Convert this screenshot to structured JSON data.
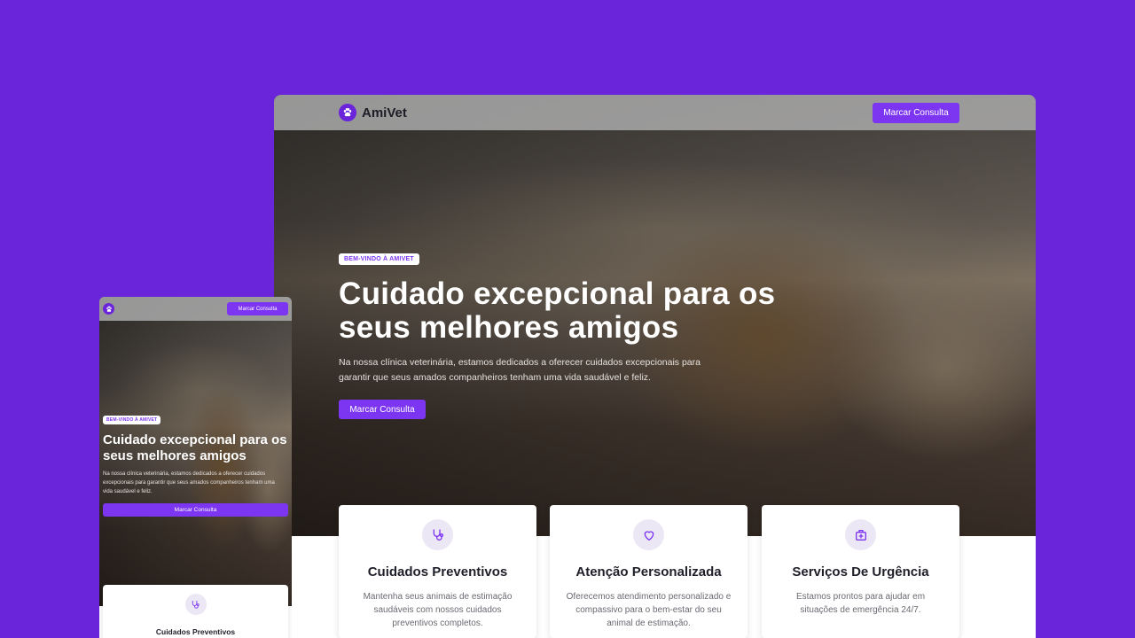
{
  "brand": {
    "name": "AmiVet",
    "logo_icon": "paw-icon"
  },
  "nav": {
    "cta_label": "Marcar Consulta"
  },
  "hero": {
    "badge": "BEM-VINDO À AMIVET",
    "title": "Cuidado excepcional para os seus melhores amigos",
    "subtitle": "Na nossa clínica veterinária, estamos dedicados a oferecer cuidados excepcionais para garantir que seus amados companheiros tenham uma vida saudável e feliz.",
    "cta_label": "Marcar Consulta"
  },
  "services": [
    {
      "icon": "stethoscope-icon",
      "title": "Cuidados Preventivos",
      "description": "Mantenha seus animais de estimação saudáveis com nossos cuidados preventivos completos."
    },
    {
      "icon": "heart-icon",
      "title": "Atenção Personalizada",
      "description": "Oferecemos atendimento personalizado e compassivo para o bem-estar do seu animal de estimação."
    },
    {
      "icon": "medical-kit-icon",
      "title": "Serviços De Urgência",
      "description": "Estamos prontos para ajudar em situações de emergência 24/7."
    }
  ],
  "colors": {
    "background": "#6a24d9",
    "accent": "#7c35f0",
    "badge_text": "#7c35f0"
  }
}
